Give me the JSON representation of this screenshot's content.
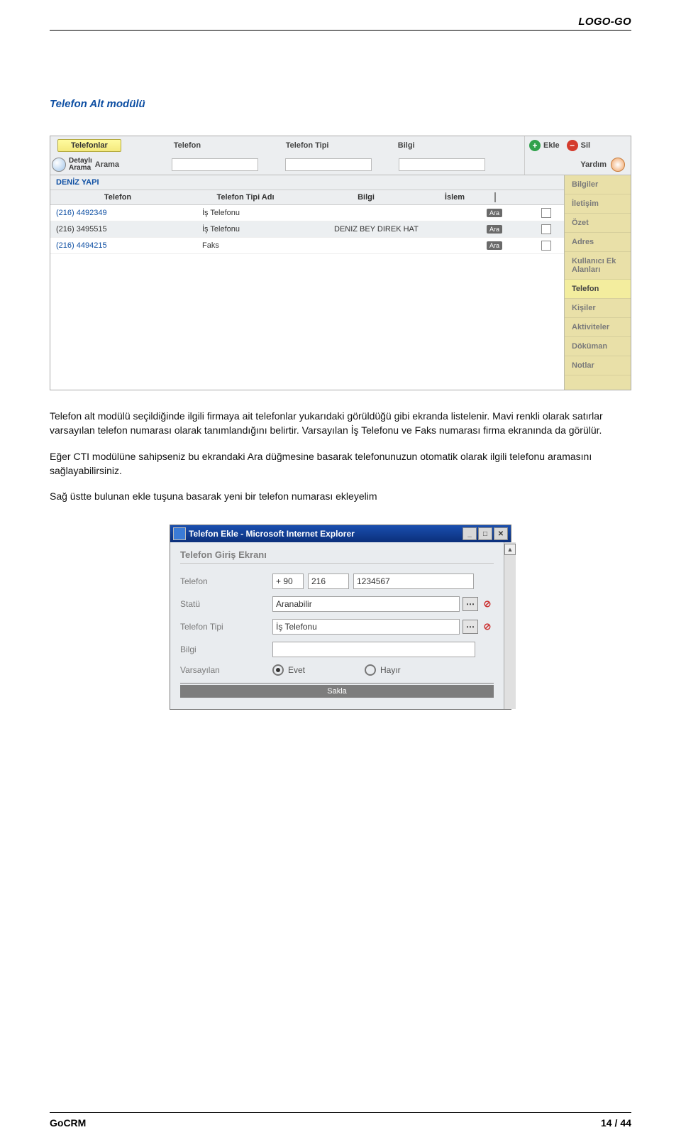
{
  "brand": "LOGO-GO",
  "section_title": "Telefon Alt modülü",
  "toolbar": {
    "tab_active": "Telefonlar",
    "headers": {
      "telefon": "Telefon",
      "tip": "Telefon Tipi",
      "bilgi": "Bilgi"
    },
    "search_line1": "Detaylı",
    "search_line2": "Arama",
    "search_label": "Arama",
    "ekle": "Ekle",
    "sil": "Sil",
    "help": "Yardım"
  },
  "company_name": "DENİZ YAPI",
  "grid_headers": {
    "telefon": "Telefon",
    "tip_ad": "Telefon Tipi Adı",
    "bilgi": "Bilgi",
    "islem": "İslem"
  },
  "rows": [
    {
      "tel": "(216) 4492349",
      "tip": "İş Telefonu",
      "bilgi": "",
      "ara": "Ara"
    },
    {
      "tel": "(216) 3495515",
      "tip": "İş Telefonu",
      "bilgi": "DENIZ BEY DIREK HAT",
      "ara": "Ara"
    },
    {
      "tel": "(216) 4494215",
      "tip": "Faks",
      "bilgi": "",
      "ara": "Ara"
    }
  ],
  "sidebar": [
    "Bilgiler",
    "İletişim",
    "Özet",
    "Adres",
    "Kullanıcı Ek Alanları",
    "Telefon",
    "Kişiler",
    "Aktiviteler",
    "Döküman",
    "Notlar"
  ],
  "sidebar_active_index": 5,
  "body_paragraphs": [
    "Telefon alt modülü seçildiğinde ilgili firmaya ait telefonlar yukarıdaki görüldüğü gibi ekranda listelenir. Mavi renkli olarak satırlar varsayılan telefon numarası olarak tanımlandığını belirtir. Varsayılan İş Telefonu ve Faks numarası firma ekranında da görülür.",
    "Eğer CTI modülüne sahipseniz bu ekrandaki Ara düğmesine basarak telefonunuzun otomatik olarak ilgili telefonu aramasını sağlayabilirsiniz.",
    "Sağ üstte bulunan ekle tuşuna basarak yeni bir telefon numarası ekleyelim"
  ],
  "dialog": {
    "title": "Telefon Ekle - Microsoft Internet Explorer",
    "head": "Telefon Giriş Ekranı",
    "labels": {
      "telefon": "Telefon",
      "statu": "Statü",
      "tip": "Telefon Tipi",
      "bilgi": "Bilgi",
      "varsay": "Varsayılan"
    },
    "tel_cc": "+ 90",
    "tel_area": "216",
    "tel_num": "1234567",
    "statu_val": "Aranabilir",
    "tip_val": "İş Telefonu",
    "bilgi_val": "",
    "evet": "Evet",
    "hayir": "Hayır",
    "save": "Sakla"
  },
  "footer": {
    "left": "GoCRM",
    "page": "14",
    "sep": "/",
    "total": "44"
  }
}
